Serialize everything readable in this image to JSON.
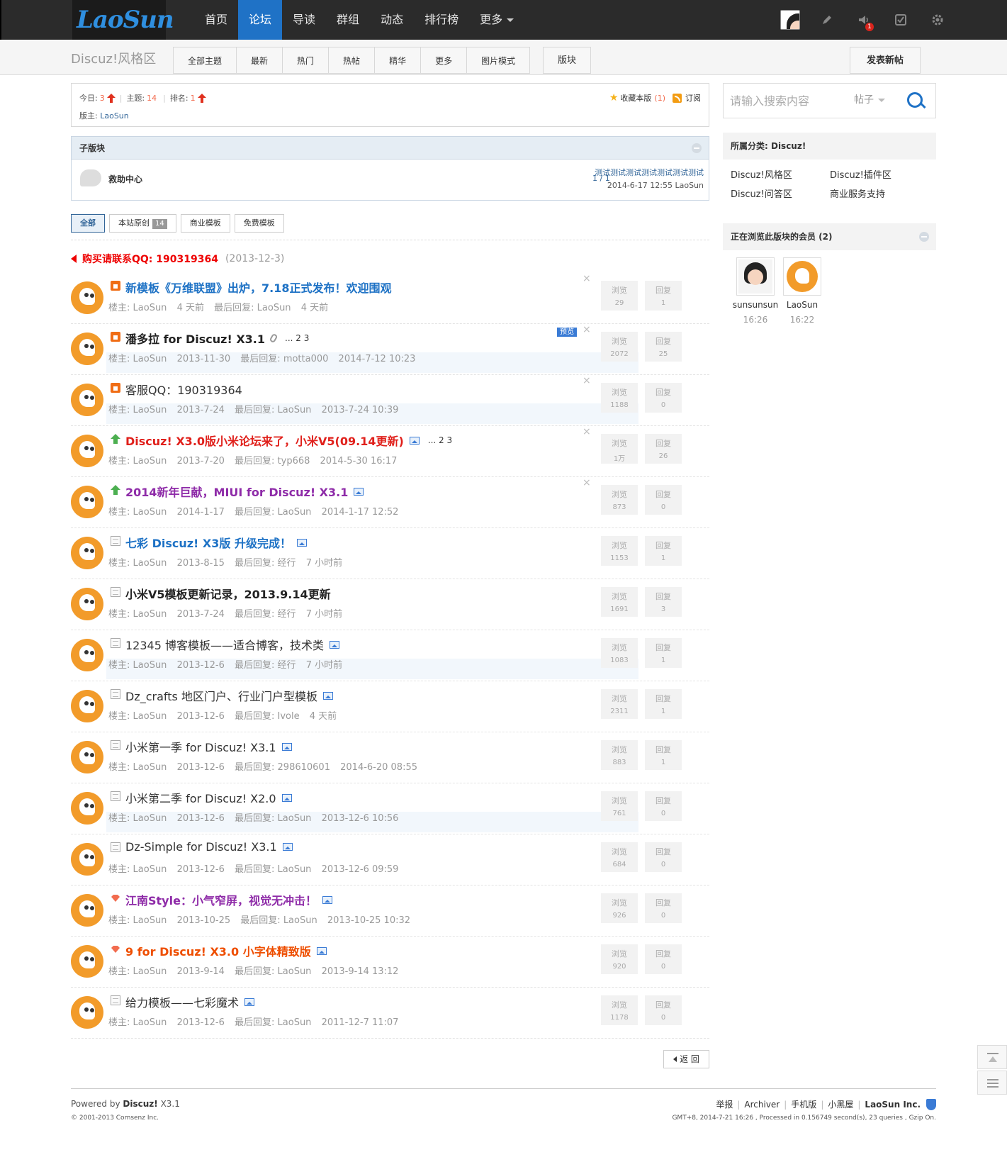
{
  "logo": "LaoSun",
  "nav": {
    "items": [
      "首页",
      "论坛",
      "导读",
      "群组",
      "动态",
      "排行榜"
    ],
    "more": "更多",
    "active_index": 1,
    "notification_count": "1"
  },
  "subnav": {
    "forum_title": "Discuz!风格区",
    "tabs": [
      "全部主题",
      "最新",
      "热门",
      "热帖",
      "精华",
      "更多",
      "图片模式"
    ],
    "block_tab": "版块",
    "post_button": "发表新帖"
  },
  "stats": {
    "today_label": "今日:",
    "today": "3",
    "topics_label": "主题:",
    "topics": "14",
    "rank_label": "排名:",
    "rank": "1",
    "moderator_label": "版主:",
    "moderator": "LaoSun",
    "favorite_label": "收藏本版",
    "favorite_count": "(1)",
    "subscribe_label": "订阅"
  },
  "subforum": {
    "header": "子版块",
    "name": "救助中心",
    "count": "1 / 1",
    "last_title": "测试测试测试测试测试测试测试",
    "last_meta": "2014-6-17 12:55 LaoSun"
  },
  "filters": {
    "all": "全部",
    "original": "本站原创",
    "original_count": "14",
    "commercial": "商业模板",
    "free": "免费模板"
  },
  "announcement": {
    "label": "购买请联系QQ: 190319364",
    "date": "(2013-12-3)"
  },
  "meta_labels": {
    "author": "楼主:",
    "last_reply": "最后回复:",
    "views": "浏览",
    "replies": "回复",
    "preview": "预览"
  },
  "threads": [
    {
      "title": "新模板《万维联盟》出炉，7.18正式发布！欢迎围观",
      "author": "LaoSun",
      "date": "4 天前",
      "last_user": "LaoSun",
      "last_time": "4 天前",
      "views": "29",
      "replies": "1"
    },
    {
      "title": "潘多拉 for Discuz! X3.1",
      "pages": "... 2  3",
      "author": "LaoSun",
      "date": "2013-11-30",
      "last_user": "motta000",
      "last_time": "2014-7-12 10:23",
      "views": "2072",
      "replies": "25"
    },
    {
      "title": "客服QQ：190319364",
      "author": "LaoSun",
      "date": "2013-7-24",
      "last_user": "LaoSun",
      "last_time": "2013-7-24 10:39",
      "views": "1188",
      "replies": "0"
    },
    {
      "title": "Discuz! X3.0版小米论坛来了，小米V5(09.14更新)",
      "pages": "... 2  3",
      "author": "LaoSun",
      "date": "2013-7-20",
      "last_user": "typ668",
      "last_time": "2014-5-30 16:17",
      "views": "1万",
      "replies": "26"
    },
    {
      "title": "2014新年巨献，MIUI for Discuz! X3.1",
      "author": "LaoSun",
      "date": "2014-1-17",
      "last_user": "LaoSun",
      "last_time": "2014-1-17 12:52",
      "views": "873",
      "replies": "0"
    },
    {
      "title": "七彩 Discuz! X3版 升级完成！",
      "author": "LaoSun",
      "date": "2013-8-15",
      "last_user": "经行",
      "last_time": "7 小时前",
      "views": "1153",
      "replies": "1"
    },
    {
      "title": "小米V5模板更新记录，2013.9.14更新",
      "author": "LaoSun",
      "date": "2013-7-24",
      "last_user": "经行",
      "last_time": "7 小时前",
      "views": "1691",
      "replies": "3"
    },
    {
      "title": "12345 博客模板——适合博客，技术类",
      "author": "LaoSun",
      "date": "2013-12-6",
      "last_user": "经行",
      "last_time": "7 小时前",
      "views": "1083",
      "replies": "1"
    },
    {
      "title": "Dz_crafts 地区门户、行业门户型模板",
      "author": "LaoSun",
      "date": "2013-12-6",
      "last_user": "Ivole",
      "last_time": "4 天前",
      "views": "2311",
      "replies": "1"
    },
    {
      "title": "小米第一季 for Discuz! X3.1",
      "author": "LaoSun",
      "date": "2013-12-6",
      "last_user": "298610601",
      "last_time": "2014-6-20 08:55",
      "views": "883",
      "replies": "1"
    },
    {
      "title": "小米第二季 for Discuz! X2.0",
      "author": "LaoSun",
      "date": "2013-12-6",
      "last_user": "LaoSun",
      "last_time": "2013-12-6 10:56",
      "views": "761",
      "replies": "0"
    },
    {
      "title": "Dz-Simple for Discuz! X3.1",
      "author": "LaoSun",
      "date": "2013-12-6",
      "last_user": "LaoSun",
      "last_time": "2013-12-6 09:59",
      "views": "684",
      "replies": "0"
    },
    {
      "title": "江南Style：小气窄屏，视觉无冲击！",
      "author": "LaoSun",
      "date": "2013-10-25",
      "last_user": "LaoSun",
      "last_time": "2013-10-25 10:32",
      "views": "926",
      "replies": "0"
    },
    {
      "title": "9 for Discuz! X3.0 小字体精致版",
      "author": "LaoSun",
      "date": "2013-9-14",
      "last_user": "LaoSun",
      "last_time": "2013-9-14 13:12",
      "views": "920",
      "replies": "0"
    },
    {
      "title": "给力模板——七彩魔术",
      "author": "LaoSun",
      "date": "2013-12-6",
      "last_user": "LaoSun",
      "last_time": "2011-12-7 11:07",
      "views": "1178",
      "replies": "0"
    }
  ],
  "back_button": "返 回",
  "sidebar": {
    "search_placeholder": "请输入搜索内容",
    "search_type": "帖子",
    "category_title": "所属分类: Discuz!",
    "categories": [
      "Discuz!风格区",
      "Discuz!插件区",
      "Discuz!问答区",
      "商业服务支持"
    ],
    "browsing_title": "正在浏览此版块的会员 (2)",
    "members": [
      {
        "name": "sunsunsun",
        "time": "16:26"
      },
      {
        "name": "LaoSun",
        "time": "16:22"
      }
    ]
  },
  "footer": {
    "powered_prefix": "Powered by",
    "powered_name": "Discuz!",
    "powered_version": "X3.1",
    "copyright": "© 2001-2013 Comsenz Inc.",
    "links": [
      "举报",
      "Archiver",
      "手机版",
      "小黑屋"
    ],
    "company": "LaoSun Inc.",
    "info": "GMT+8, 2014-7-21 16:26 , Processed in 0.156749 second(s), 23 queries , Gzip On."
  }
}
